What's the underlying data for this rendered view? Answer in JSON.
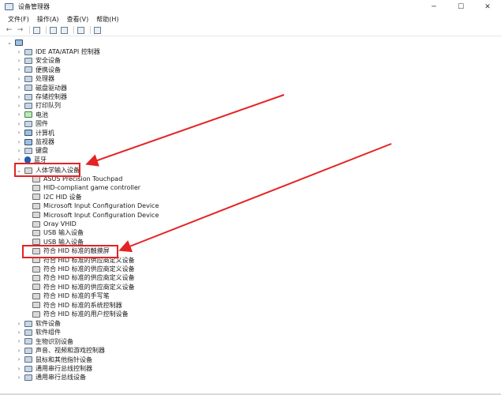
{
  "window": {
    "title": "设备管理器",
    "minimize": "─",
    "maximize": "☐",
    "close": "✕"
  },
  "menu": [
    "文件(F)",
    "操作(A)",
    "查看(V)",
    "帮助(H)"
  ],
  "toolbar": {
    "back": "←",
    "forward": "→"
  },
  "tree": {
    "categories_top": [
      "IDE ATA/ATAPI 控制器",
      "安全设备",
      "便携设备",
      "处理器",
      "磁盘驱动器",
      "存储控制器",
      "打印队列",
      "电池",
      "固件",
      "计算机",
      "监视器",
      "键盘",
      "蓝牙"
    ],
    "expanded_category": "人体学输入设备",
    "children": [
      "ASUS Precision Touchpad",
      "HID-compliant game controller",
      "I2C HID 设备",
      "Microsoft Input Configuration Device",
      "Microsoft Input Configuration Device",
      "Oray VHID",
      "USB 输入设备",
      "USB 输入设备",
      "符合 HID 标准的触摸屏",
      "符合 HID 标准的供应商定义设备",
      "符合 HID 标准的供应商定义设备",
      "符合 HID 标准的供应商定义设备",
      "符合 HID 标准的供应商定义设备",
      "符合 HID 标准的手写笔",
      "符合 HID 标准的系统控制器",
      "符合 HID 标准的用户控制设备"
    ],
    "categories_bottom": [
      "软件设备",
      "软件组件",
      "生物识别设备",
      "声音、视频和游戏控制器",
      "鼠标和其他指针设备",
      "通用串行总线控制器",
      "通用串行总线设备"
    ]
  },
  "colors": {
    "annotation": "#e52222"
  }
}
